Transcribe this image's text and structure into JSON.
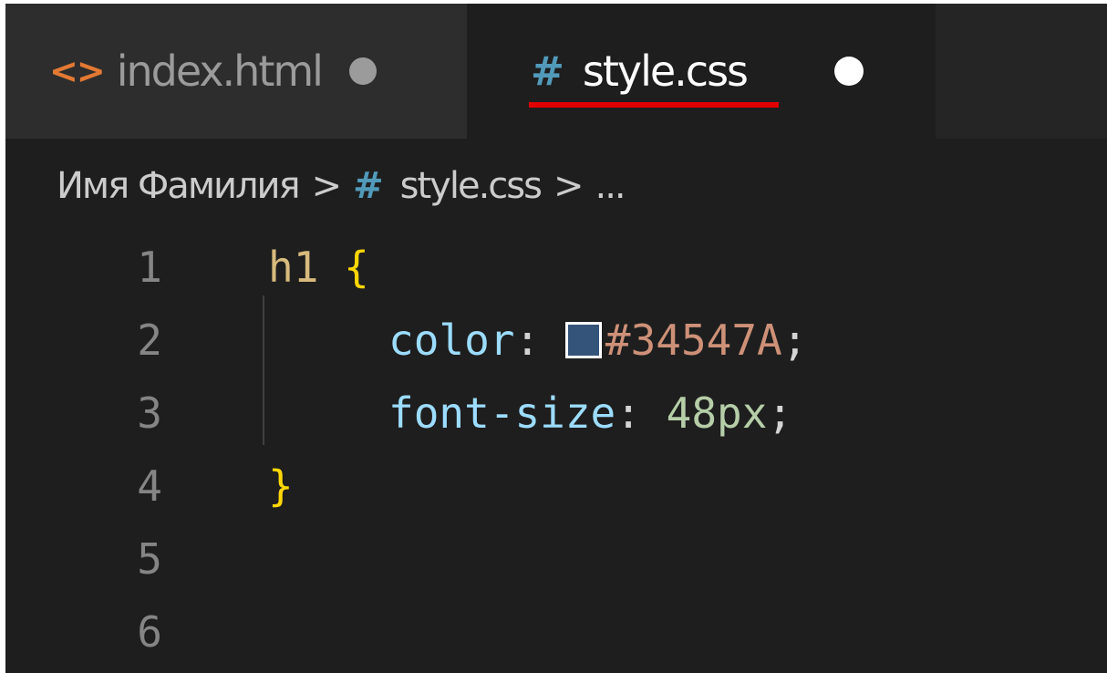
{
  "tabs": [
    {
      "label": "index.html",
      "icon": "html-file-icon",
      "icon_glyph": "<>",
      "active": false,
      "modified": true
    },
    {
      "label": "style.css",
      "icon": "css-file-icon",
      "icon_glyph": "#",
      "active": true,
      "modified": true
    }
  ],
  "breadcrumb": {
    "folder": "Имя Фамилия",
    "separator": ">",
    "file_icon_glyph": "#",
    "file": "style.css",
    "ellipsis": "..."
  },
  "editor": {
    "line_numbers": [
      "1",
      "2",
      "3",
      "4",
      "5",
      "6"
    ],
    "lines": [
      {
        "selector": "h1",
        "open_brace": "{"
      },
      {
        "property": "color",
        "colon": ":",
        "swatch_color": "#34547A",
        "value": "#34547A",
        "semicolon": ";"
      },
      {
        "property": "font-size",
        "colon": ":",
        "value": "48px",
        "semicolon": ";"
      },
      {
        "close_brace": "}"
      }
    ]
  },
  "colors": {
    "editor_bg": "#1e1e1e",
    "tab_inactive_bg": "#2d2d2d",
    "highlight_underline": "#e00000",
    "css_icon": "#519aba",
    "html_icon": "#e37933"
  }
}
